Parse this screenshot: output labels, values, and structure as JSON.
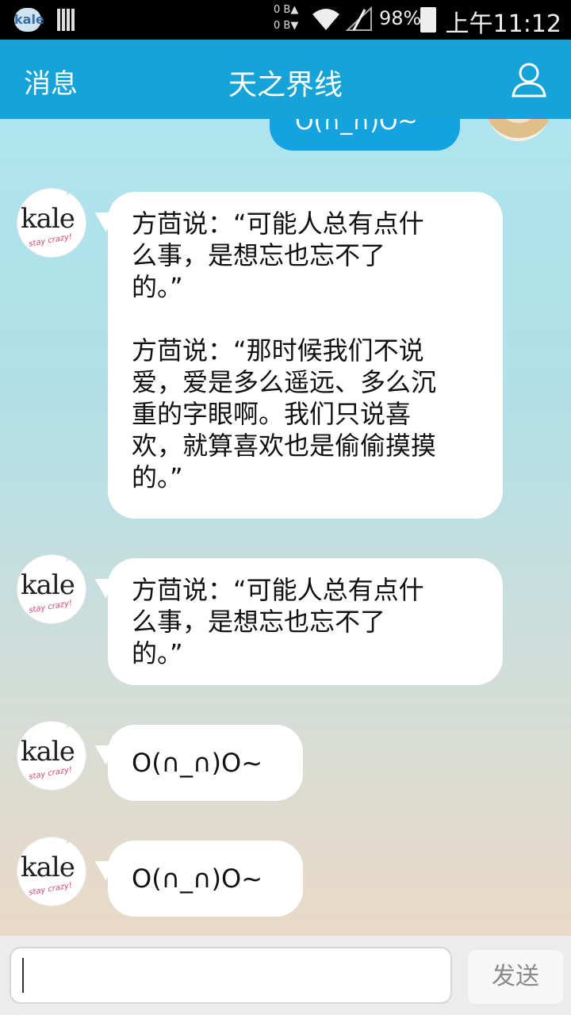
{
  "status_bar": {
    "app_badge": "kale",
    "net_up": "0 B▲",
    "net_down": "0 B▼",
    "battery": "98%",
    "time": "上午11:12"
  },
  "header": {
    "back_label": "消息",
    "title": "天之界线",
    "profile_icon": "person-outline-icon"
  },
  "messages": [
    {
      "side": "right",
      "text": "O(∩_∩)O~",
      "partial": true
    },
    {
      "side": "left",
      "avatar_text": "kale",
      "avatar_sub": "stay crazy!",
      "text": "方茴说：“可能人总有点什\n么事，是想忘也忘不了\n的。”\n\n方茴说：“那时候我们不说\n爱，爱是多么遥远、多么沉\n重的字眼啊。我们只说喜\n欢，就算喜欢也是偷偷摸摸\n的。”"
    },
    {
      "side": "left",
      "avatar_text": "kale",
      "avatar_sub": "stay crazy!",
      "text": "方茴说：“可能人总有点什\n么事，是想忘也忘不了\n的。”"
    },
    {
      "side": "left",
      "avatar_text": "kale",
      "avatar_sub": "stay crazy!",
      "text": "O(∩_∩)O~"
    },
    {
      "side": "left",
      "avatar_text": "kale",
      "avatar_sub": "stay crazy!",
      "text": "O(∩_∩)O~"
    }
  ],
  "input": {
    "value": "",
    "send_label": "发送"
  }
}
